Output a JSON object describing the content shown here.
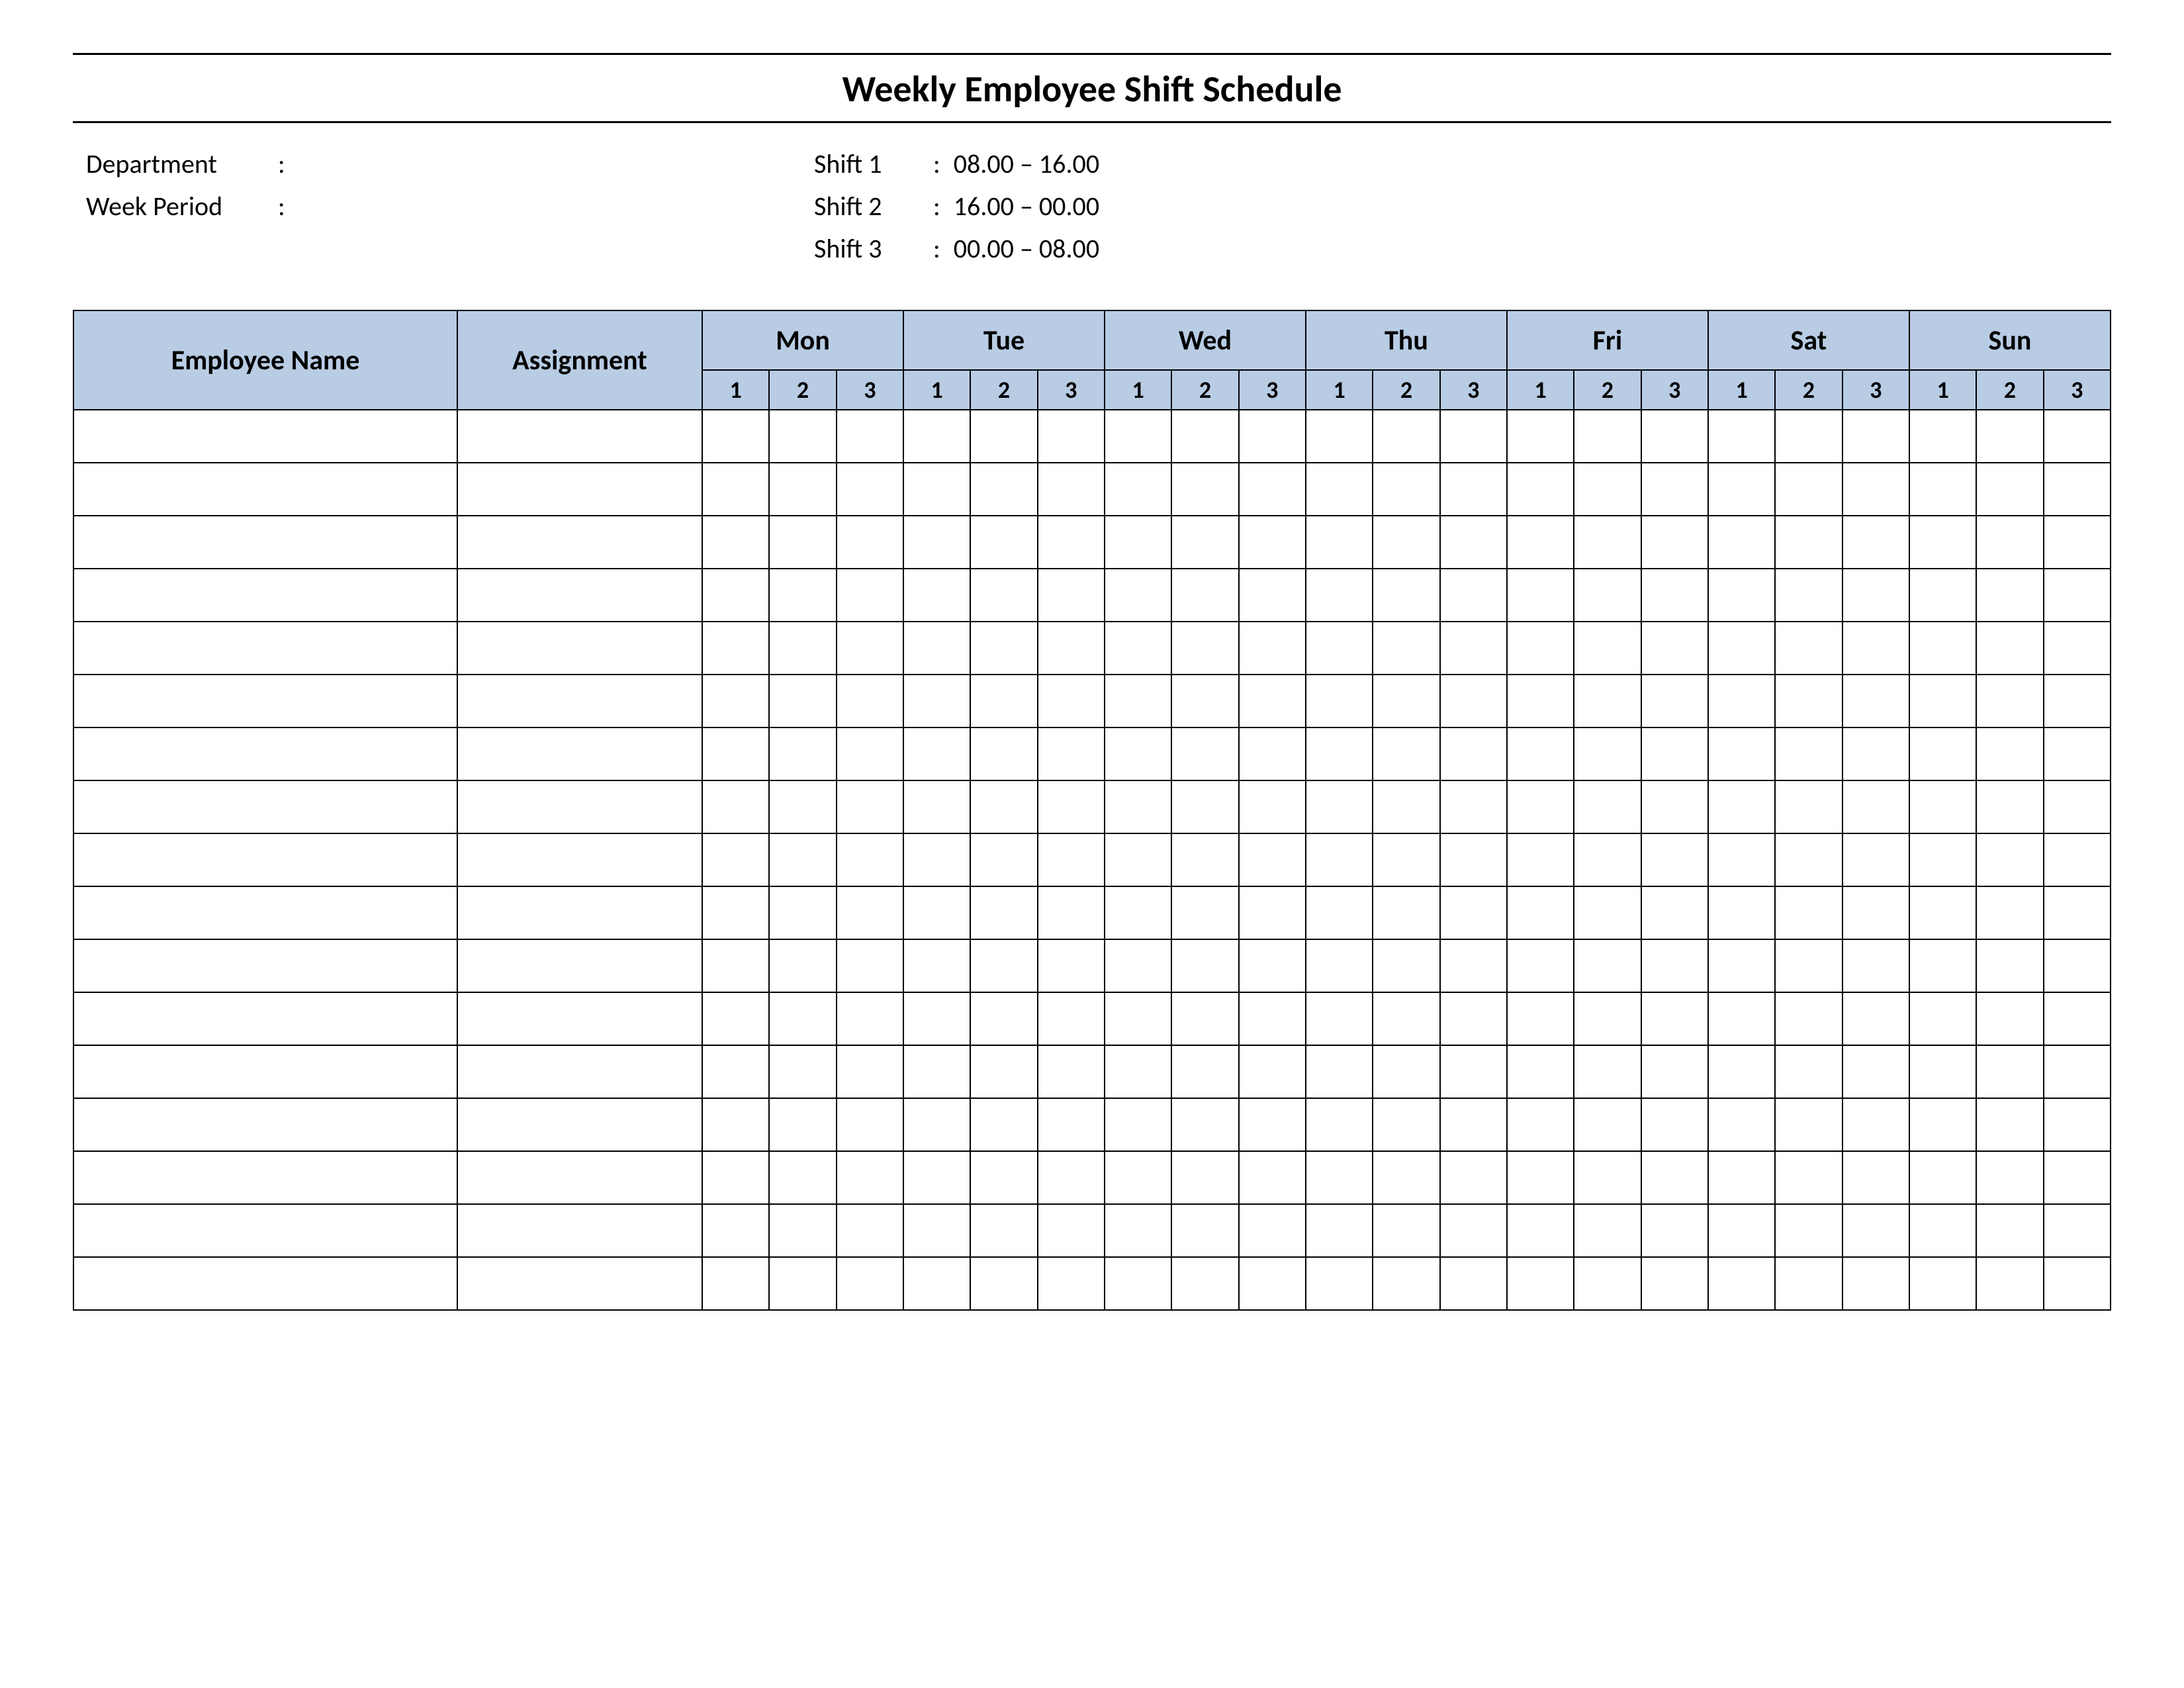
{
  "title": "Weekly Employee Shift Schedule",
  "meta": {
    "left": [
      {
        "label": "Department",
        "sep": ":",
        "value": ""
      },
      {
        "label": "Week  Period",
        "sep": ":",
        "value": ""
      }
    ],
    "right": [
      {
        "label": "Shift 1",
        "sep": ":",
        "value": "08.00  – 16.00"
      },
      {
        "label": "Shift 2",
        "sep": ":",
        "value": "16.00  – 00.00"
      },
      {
        "label": "Shift 3",
        "sep": ":",
        "value": "00.00  – 08.00"
      }
    ]
  },
  "headers": {
    "employee": "Employee Name",
    "assignment": "Assignment",
    "days": [
      "Mon",
      "Tue",
      "Wed",
      "Thu",
      "Fri",
      "Sat",
      "Sun"
    ],
    "shifts": [
      "1",
      "2",
      "3"
    ]
  },
  "row_count": 17
}
